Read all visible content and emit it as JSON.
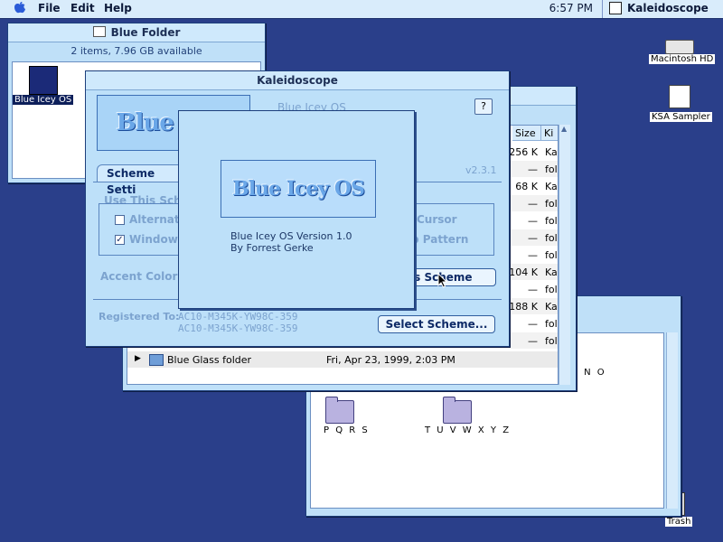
{
  "menubar": {
    "items": [
      "File",
      "Edit",
      "Help"
    ],
    "clock": "6:57 PM",
    "app_name": "Kaleidoscope"
  },
  "desktop": {
    "icons": [
      {
        "label": "Macintosh HD",
        "icon": "hard-disk-icon"
      },
      {
        "label": "KSA Sampler",
        "icon": "document-pen-icon"
      },
      {
        "label": "Trash",
        "icon": "trash-icon"
      }
    ]
  },
  "blue_folder_window": {
    "title": "Blue Folder",
    "info": "2 items, 7.96 GB available",
    "items": [
      {
        "label": "Blue Icey OS"
      }
    ]
  },
  "list_window": {
    "columns": [
      "Size",
      "Ki"
    ],
    "rows": [
      {
        "size": "256 K",
        "kind": "Ka"
      },
      {
        "size": "—",
        "kind": "fol"
      },
      {
        "size": "68 K",
        "kind": "Ka"
      },
      {
        "size": "—",
        "kind": "fol"
      },
      {
        "size": "—",
        "kind": "fol"
      },
      {
        "size": "—",
        "kind": "fol"
      },
      {
        "size": "—",
        "kind": "fol"
      },
      {
        "size": "104 K",
        "kind": "Ka"
      },
      {
        "size": "—",
        "kind": "fol"
      },
      {
        "size": "188 K",
        "kind": "Ka"
      },
      {
        "size": "—",
        "kind": "fol"
      },
      {
        "size": "—",
        "kind": "fol"
      },
      {
        "size": "—",
        "kind": "fol"
      }
    ],
    "folder_row": {
      "name": "Blue Glass folder",
      "date": "Fri, Apr 23, 1999, 2:03 PM"
    }
  },
  "icon_window": {
    "folders": [
      {
        "label": "P Q R S"
      },
      {
        "label": "T U V W X Y Z"
      },
      {
        "label": "I N O"
      }
    ]
  },
  "kaleidoscope_window": {
    "title": "Kaleidoscope",
    "scheme_name": "Blue Icey OS",
    "version": "v2.3.1",
    "tab_label": "Scheme Setti",
    "group_label": "Use This Sche",
    "checkbox_1": "Alternate",
    "checkbox_2": "Window",
    "cursor_label": "Cursor",
    "pattern_label": "p Pattern",
    "accent_label": "Accent Color:",
    "use_scheme_button": "his Scheme",
    "registered_label": "Registered To:",
    "registration_1": "AC10-M345K-YW98C-359",
    "registration_2": "AC10-M345K-YW98C-359",
    "select_button": "Select Scheme...",
    "logo_text": "Blue Icey"
  },
  "about_dialog": {
    "logo_text": "Blue Icey OS",
    "version_line": "Blue Icey OS Version 1.0",
    "author_line": "By Forrest Gerke"
  }
}
